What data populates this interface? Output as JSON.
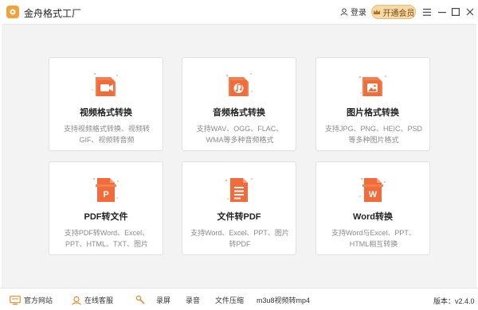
{
  "app": {
    "title": "金舟格式工厂",
    "accent": "#f26b3a"
  },
  "header": {
    "login_label": "登录",
    "vip_label": "开通会员"
  },
  "cards": [
    {
      "title": "视频格式转换",
      "desc": "支持视频格式转换、视频转GIF、视频转音频",
      "icon": "video-file-icon"
    },
    {
      "title": "音频格式转换",
      "desc": "支持WAV、OGG、FLAC、WMA等多种音频格式",
      "icon": "audio-file-icon"
    },
    {
      "title": "图片格式转换",
      "desc": "支持JPG、PNG、HEIC、PSD等多种图片格式",
      "icon": "image-file-icon"
    },
    {
      "title": "PDF转文件",
      "desc": "支持PDF转Word、Excel、PPT、HTML、TXT、图片",
      "icon": "pdf-file-icon",
      "glyph": "P"
    },
    {
      "title": "文件转PDF",
      "desc": "支持Word、Excel、PPT、图片转PDF",
      "icon": "doc-file-icon"
    },
    {
      "title": "Word转换",
      "desc": "支持Word与Excel、PPT、HTML相互转换",
      "icon": "word-file-icon",
      "glyph": "W"
    }
  ],
  "statusbar": {
    "website": "官方网站",
    "support": "在线客服",
    "record": "录屏",
    "audio": "录音",
    "compress": "文件压缩",
    "convert": "m3u8视频转mp4",
    "version": "版本：v2.4.0"
  }
}
